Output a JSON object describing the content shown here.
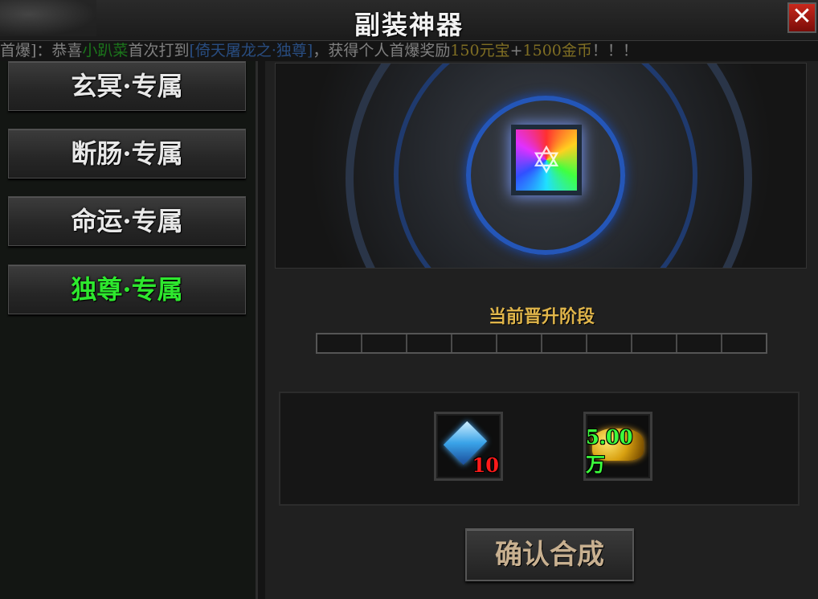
{
  "window": {
    "title": "副装神器",
    "close_icon": "close-icon"
  },
  "announcement": {
    "prefix": "首爆]：恭喜",
    "player": "小趴菜",
    "middle": "首次打到",
    "item": "[倚天屠龙之·独尊]",
    "reward_text": "，获得个人首爆奖励",
    "reward1": "150元宝",
    "sep": "+",
    "reward2": "1500金币",
    "suffix": "！！！"
  },
  "sidebar": {
    "items": [
      {
        "label": "玄冥·专属",
        "active": false
      },
      {
        "label": "断肠·专属",
        "active": false
      },
      {
        "label": "命运·专属",
        "active": false
      },
      {
        "label": "独尊·专属",
        "active": true
      }
    ]
  },
  "main": {
    "stage_label": "当前晋升阶段",
    "stage_progress": 0,
    "stage_segments": 10,
    "materials": [
      {
        "icon": "crystal-icon",
        "quantity": "10",
        "color": "#ff1a1a"
      },
      {
        "icon": "gold-coins-icon",
        "quantity": "5.00万",
        "color": "#3cff3c"
      }
    ],
    "confirm_label": "确认合成"
  },
  "colors": {
    "active_tab": "#2ee82e",
    "stage_label": "#e0b54a",
    "close_button": "#c8281c"
  }
}
